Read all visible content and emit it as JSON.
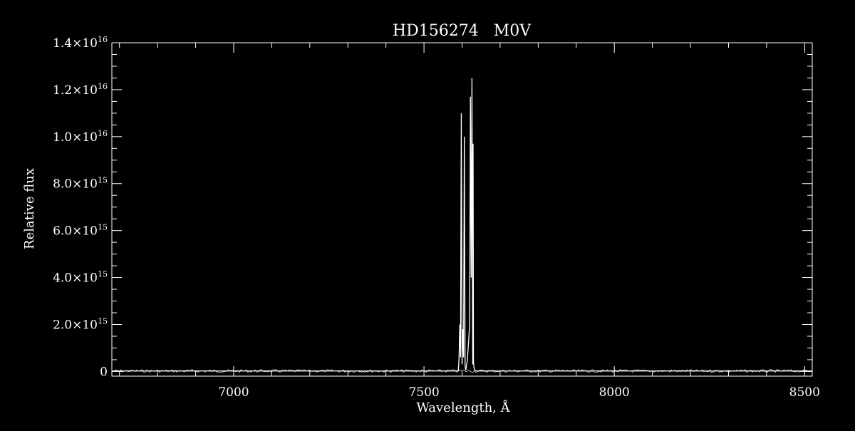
{
  "chart_data": {
    "type": "line",
    "title": "HD156274   M0V",
    "xlabel": "Wavelength, Å",
    "ylabel": "Relative flux",
    "xlim": [
      6680,
      8520
    ],
    "ylim": [
      -200000000000000.0,
      1.4e+16
    ],
    "x_ticks": [
      7000,
      7500,
      8000,
      8500
    ],
    "x_tick_labels": [
      "7000",
      "7500",
      "8000",
      "8500"
    ],
    "y_ticks": [
      0,
      2000000000000000.0,
      4000000000000000.0,
      6000000000000000.0,
      8000000000000000.0,
      1e+16,
      1.2e+16,
      1.4e+16
    ],
    "y_tick_labels": [
      {
        "mantissa": "0",
        "exponent": ""
      },
      {
        "mantissa": "2.0×10",
        "exponent": "15"
      },
      {
        "mantissa": "4.0×10",
        "exponent": "15"
      },
      {
        "mantissa": "6.0×10",
        "exponent": "15"
      },
      {
        "mantissa": "8.0×10",
        "exponent": "15"
      },
      {
        "mantissa": "1.0×10",
        "exponent": "16"
      },
      {
        "mantissa": "1.2×10",
        "exponent": "16"
      },
      {
        "mantissa": "1.4×10",
        "exponent": "16"
      }
    ],
    "grid": false,
    "baseline_level": 20000000000000.0,
    "series": [
      {
        "x": [
          6680,
          7590,
          7592,
          7594,
          7596,
          7598,
          7600,
          7602,
          7604,
          7606,
          7608,
          7610,
          7614,
          7618,
          7620,
          7622,
          7624,
          7626,
          7628,
          7629,
          7630,
          7632,
          7634,
          7636,
          7640,
          7650,
          8520
        ],
        "y": [
          20000000000000.0,
          20000000000000.0,
          500000000000000.0,
          2000000000000000.0,
          600000000000000.0,
          1.1e+16,
          300000000000000.0,
          1800000000000000.0,
          600000000000000.0,
          1e+16,
          200000000000000.0,
          60000000000000.0,
          500000000000000.0,
          1500000000000000.0,
          2000000000000000.0,
          1.17e+16,
          4000000000000000.0,
          1.25e+16,
          300000000000000.0,
          9700000000000000.0,
          400000000000000.0,
          100000000000000.0,
          40000000000000.0,
          30000000000000.0,
          20000000000000.0,
          20000000000000.0,
          20000000000000.0
        ]
      }
    ],
    "line_color": "#ffffff",
    "background_color": "#000000"
  }
}
